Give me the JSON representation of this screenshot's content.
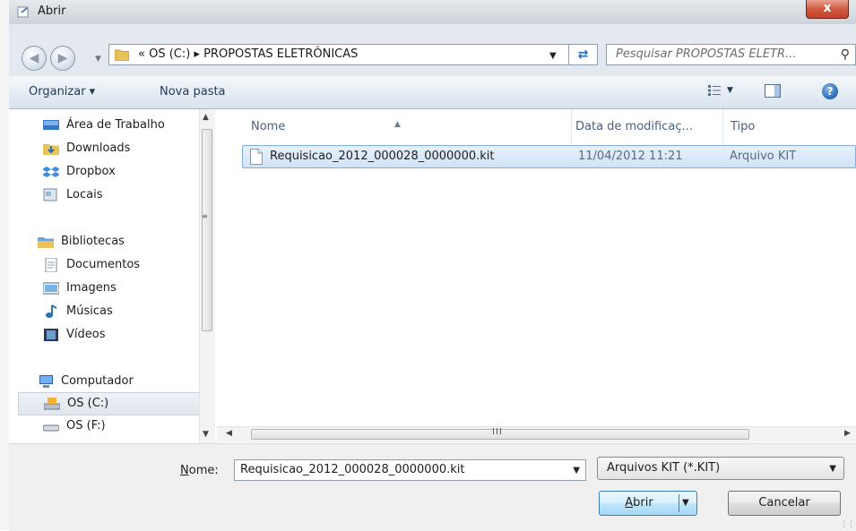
{
  "window": {
    "title": "Abrir",
    "close_label": "x"
  },
  "address": {
    "path_text": "« OS (C:) ▸ PROPOSTAS ELETRÔNICAS",
    "search_placeholder": "Pesquisar PROPOSTAS ELETR..."
  },
  "toolbar": {
    "organize": "Organizar ▾",
    "new_folder": "Nova pasta"
  },
  "navigation": {
    "items": [
      {
        "label": "Área de Trabalho",
        "icon": "desktop-icon"
      },
      {
        "label": "Downloads",
        "icon": "downloads-folder-icon"
      },
      {
        "label": "Dropbox",
        "icon": "dropbox-icon"
      },
      {
        "label": "Locais",
        "icon": "places-icon"
      },
      {
        "label": "Bibliotecas",
        "icon": "libraries-icon"
      },
      {
        "label": "Documentos",
        "icon": "documents-icon"
      },
      {
        "label": "Imagens",
        "icon": "pictures-icon"
      },
      {
        "label": "Músicas",
        "icon": "music-icon"
      },
      {
        "label": "Vídeos",
        "icon": "videos-icon"
      },
      {
        "label": "Computador",
        "icon": "computer-icon"
      },
      {
        "label": "OS (C:)",
        "icon": "drive-c-icon",
        "selected": true
      },
      {
        "label": "OS (F:)",
        "icon": "drive-f-icon"
      }
    ]
  },
  "file_list": {
    "columns": [
      "Nome",
      "Data de modificaç...",
      "Tipo"
    ],
    "rows": [
      {
        "name": "Requisicao_2012_000028_0000000.kit",
        "modified": "11/04/2012 11:21",
        "type": "Arquivo KIT",
        "selected": true
      }
    ]
  },
  "footer": {
    "name_label_underlined": "N",
    "name_label_rest": "ome:",
    "file_name_value": "Requisicao_2012_000028_0000000.kit",
    "file_type_value": "Arquivos KIT (*.KIT)",
    "open_label_underlined": "A",
    "open_label_rest": "brir",
    "cancel_label": "Cancelar"
  },
  "colors": {
    "selection": "#d0e3f7",
    "selection_border": "#84acdd",
    "close_red": "#c2402a"
  }
}
